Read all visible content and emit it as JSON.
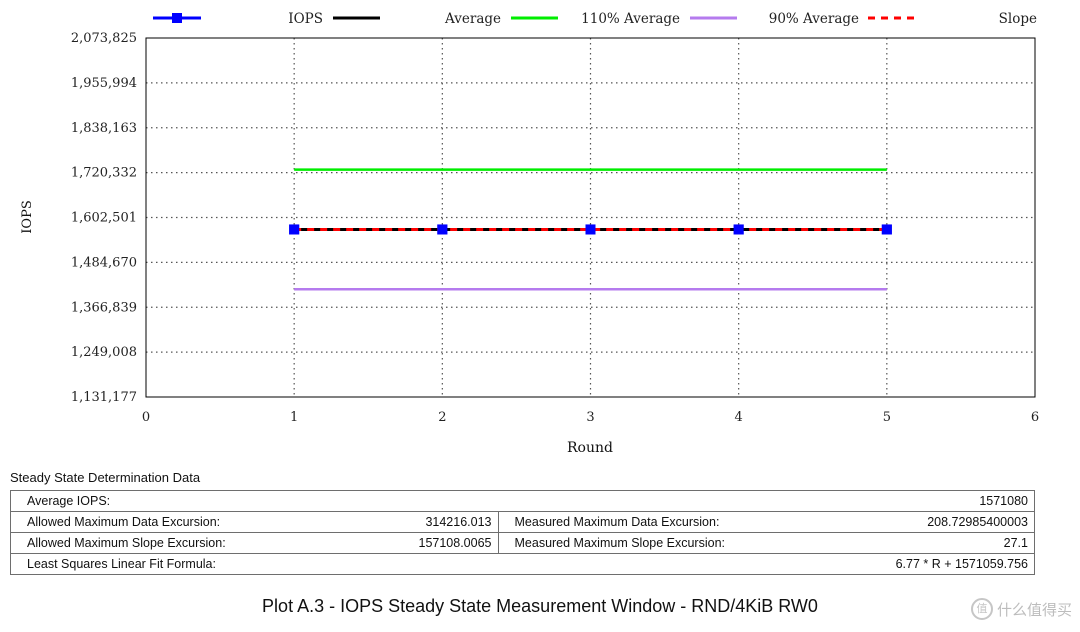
{
  "chart_data": {
    "type": "line",
    "xlabel": "Round",
    "ylabel": "IOPS",
    "xlim": [
      0,
      6
    ],
    "ylim": [
      1131177,
      2073825
    ],
    "x_ticks": [
      "0",
      "1",
      "2",
      "3",
      "4",
      "5",
      "6"
    ],
    "y_ticks": [
      "1,131,177",
      "1,249,008",
      "1,366,839",
      "1,484,670",
      "1,602,501",
      "1,720,332",
      "1,838,163",
      "1,955,994",
      "2,073,825"
    ],
    "grid": true,
    "legend_position": "top",
    "x": [
      1,
      2,
      3,
      4,
      5
    ],
    "series": [
      {
        "name": "IOPS",
        "values": [
          1571080,
          1571080,
          1571080,
          1571080,
          1571080
        ],
        "color": "#0000ff",
        "style": "line-square-markers"
      },
      {
        "name": "Average",
        "values": [
          1571080,
          1571080,
          1571080,
          1571080,
          1571080
        ],
        "color": "#000000",
        "style": "solid"
      },
      {
        "name": "110% Average",
        "values": [
          1728188,
          1728188,
          1728188,
          1728188,
          1728188
        ],
        "color": "#00ee00",
        "style": "solid"
      },
      {
        "name": "90% Average",
        "values": [
          1413972,
          1413972,
          1413972,
          1413972,
          1413972
        ],
        "color": "#b57bee",
        "style": "solid"
      },
      {
        "name": "Slope",
        "values": [
          1571066.53,
          1571073.3,
          1571080.07,
          1571086.84,
          1571093.61
        ],
        "color": "#ff0000",
        "style": "dashed"
      }
    ]
  },
  "steady_state": {
    "title": "Steady State Determination Data",
    "average_iops_label": "Average IOPS:",
    "average_iops_value": "1571080",
    "allowed_data_label": "Allowed Maximum Data Excursion:",
    "allowed_data_value": "314216.013",
    "measured_data_label": "Measured Maximum Data Excursion:",
    "measured_data_value": "208.72985400003",
    "allowed_slope_label": "Allowed Maximum Slope Excursion:",
    "allowed_slope_value": "157108.0065",
    "measured_slope_label": "Measured Maximum Slope Excursion:",
    "measured_slope_value": "27.1",
    "fit_label": "Least Squares Linear Fit Formula:",
    "fit_value": "6.77 * R + 1571059.756"
  },
  "caption": "Plot A.3 - IOPS Steady State Measurement Window - RND/4KiB RW0",
  "watermark": "什么值得买"
}
